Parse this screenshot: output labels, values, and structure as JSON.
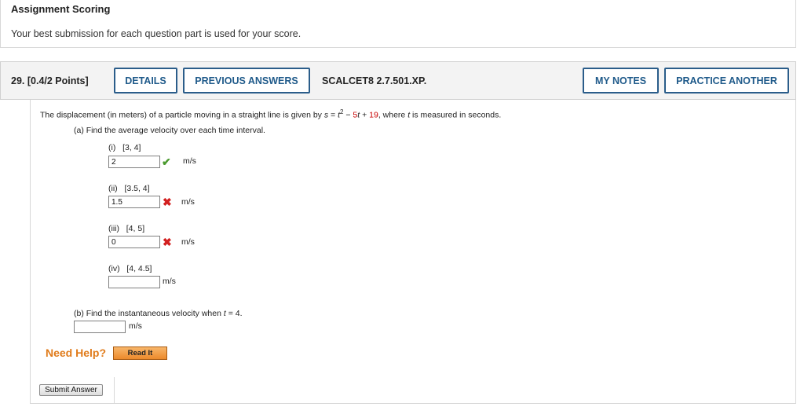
{
  "scoring": {
    "title": "Assignment Scoring",
    "text": "Your best submission for each question part is used for your score."
  },
  "question": {
    "number": "29.",
    "points": "[0.4/2 Points]",
    "details_label": "DETAILS",
    "previous_answers_label": "PREVIOUS ANSWERS",
    "code": "SCALCET8 2.7.501.XP.",
    "my_notes_label": "MY NOTES",
    "practice_another_label": "PRACTICE ANOTHER"
  },
  "problem": {
    "intro_prefix": "The displacement (in meters) of a particle moving in a straight line is given by ",
    "s_var": "s",
    "equals": " = ",
    "t_var": "t",
    "exponent": "2",
    "minus": " − ",
    "coef": "5",
    "t_var2": "t",
    "plus": " + ",
    "constant": "19",
    "intro_suffix": ", where ",
    "t_var3": "t",
    "intro_end": " is measured in seconds.",
    "part_a": "(a) Find the average velocity over each time interval.",
    "intervals": [
      {
        "label": "(i)",
        "range": "[3, 4]",
        "value": "2",
        "status": "check",
        "unit": "m/s"
      },
      {
        "label": "(ii)",
        "range": "[3.5, 4]",
        "value": "1.5",
        "status": "cross",
        "unit": "m/s"
      },
      {
        "label": "(iii)",
        "range": "[4, 5]",
        "value": "0",
        "status": "cross",
        "unit": "m/s"
      },
      {
        "label": "(iv)",
        "range": "[4, 4.5]",
        "value": "",
        "status": "none",
        "unit": "m/s"
      }
    ],
    "part_b_prefix": "(b) Find the instantaneous velocity when ",
    "part_b_var": "t",
    "part_b_suffix": " = 4.",
    "part_b_value": "",
    "part_b_unit": "m/s"
  },
  "help": {
    "need_help": "Need Help?",
    "read_it": "Read It"
  },
  "submit_label": "Submit Answer",
  "icons": {
    "correct": "check-mark-icon",
    "incorrect": "x-mark-icon"
  },
  "colors": {
    "accent": "#2b5d8a",
    "correct": "#4a9a2e",
    "incorrect": "#d21f1f",
    "help": "#e07b1a",
    "equation_red": "#c80000"
  }
}
